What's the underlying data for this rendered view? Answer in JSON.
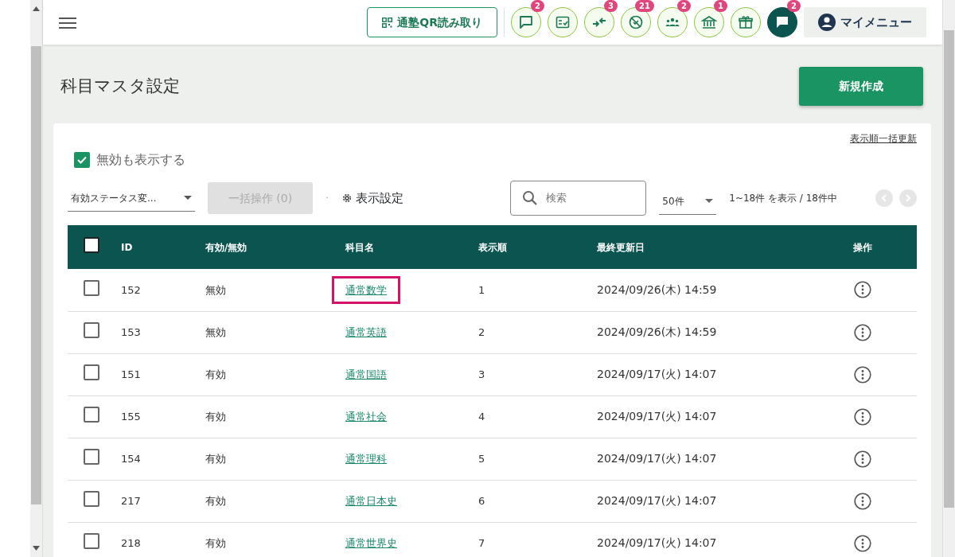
{
  "header": {
    "qr_button": "通塾QR読み取り",
    "icons": [
      {
        "kind": "chat",
        "badge": "2",
        "active": false
      },
      {
        "kind": "checklist",
        "active": false
      },
      {
        "kind": "merge",
        "badge": "3",
        "active": false
      },
      {
        "kind": "blocked",
        "badge": "21",
        "active": false
      },
      {
        "kind": "group",
        "badge": "2",
        "active": false
      },
      {
        "kind": "bank",
        "badge": "1",
        "active": false
      },
      {
        "kind": "gift",
        "active": false
      },
      {
        "kind": "chat",
        "badge": "2",
        "active": true
      }
    ],
    "my_menu": "マイメニュー"
  },
  "page_title": "科目マスタ設定",
  "create_button": "新規作成",
  "bulk_order_link": "表示順一括更新",
  "show_inactive": {
    "label": "無効も表示する",
    "checked": true
  },
  "toolbar": {
    "status_select": "有効ステータス変...",
    "bulk_button": {
      "label": "一括操作 (0)",
      "disabled": true
    },
    "separator": "·",
    "display_settings": "表示設定",
    "search_placeholder": "検索",
    "per_page": "50件",
    "range": "1~18件 を表示 / 18件中",
    "prev_disabled": true,
    "next_disabled": true
  },
  "table": {
    "all_checked": false,
    "columns": [
      "ID",
      "有効/無効",
      "科目名",
      "表示順",
      "最終更新日",
      "操作"
    ],
    "rows": [
      {
        "id": "152",
        "status": "無効",
        "name": "通常数学",
        "order": "1",
        "updated": "2024/09/26(木) 14:59",
        "checked": false,
        "highlighted": true
      },
      {
        "id": "153",
        "status": "無効",
        "name": "通常英語",
        "order": "2",
        "updated": "2024/09/26(木) 14:59",
        "checked": false,
        "highlighted": false
      },
      {
        "id": "151",
        "status": "有効",
        "name": "通常国語",
        "order": "3",
        "updated": "2024/09/17(火) 14:07",
        "checked": false,
        "highlighted": false
      },
      {
        "id": "155",
        "status": "有効",
        "name": "通常社会",
        "order": "4",
        "updated": "2024/09/17(火) 14:07",
        "checked": false,
        "highlighted": false
      },
      {
        "id": "154",
        "status": "有効",
        "name": "通常理科",
        "order": "5",
        "updated": "2024/09/17(火) 14:07",
        "checked": false,
        "highlighted": false
      },
      {
        "id": "217",
        "status": "有効",
        "name": "通常日本史",
        "order": "6",
        "updated": "2024/09/17(火) 14:07",
        "checked": false,
        "highlighted": false
      },
      {
        "id": "218",
        "status": "有効",
        "name": "通常世界史",
        "order": "7",
        "updated": "2024/09/17(火) 14:07",
        "checked": false,
        "highlighted": false
      }
    ]
  }
}
